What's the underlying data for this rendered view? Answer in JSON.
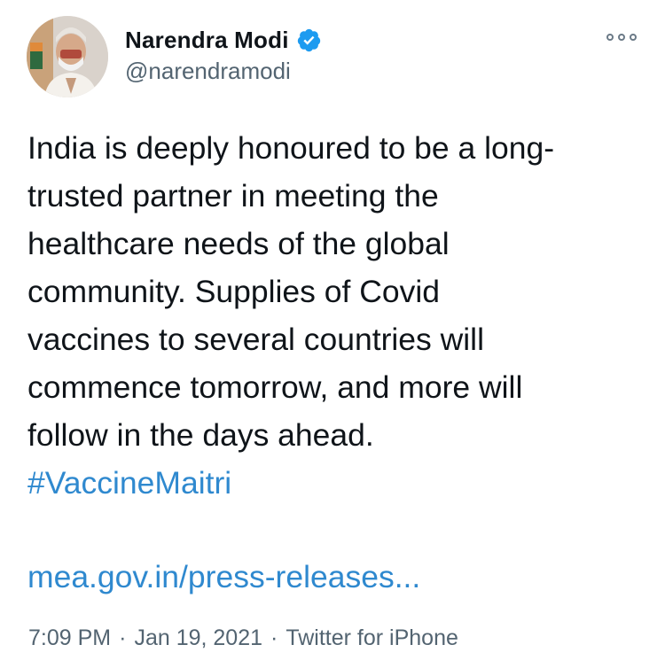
{
  "author": {
    "display_name": "Narendra Modi",
    "handle": "@narendramodi",
    "verified_icon": "verified-badge-icon",
    "avatar_icon": "profile-photo"
  },
  "menu": {
    "icon": "more-options-icon"
  },
  "tweet": {
    "lines": [
      "India is deeply honoured to be a long-",
      "trusted partner in meeting the",
      "healthcare needs of the global",
      "community. Supplies of Covid",
      "vaccines to several countries will",
      "commence tomorrow, and more will",
      "follow in the days ahead."
    ],
    "hashtag": "#VaccineMaitri",
    "link": "mea.gov.in/press-releases..."
  },
  "meta": {
    "time": "7:09 PM",
    "separator": "·",
    "date": "Jan 19, 2021",
    "source": "Twitter for iPhone"
  },
  "colors": {
    "link": "#2f89cf",
    "verified": "#1d9bf0",
    "secondary_text": "#536471"
  }
}
